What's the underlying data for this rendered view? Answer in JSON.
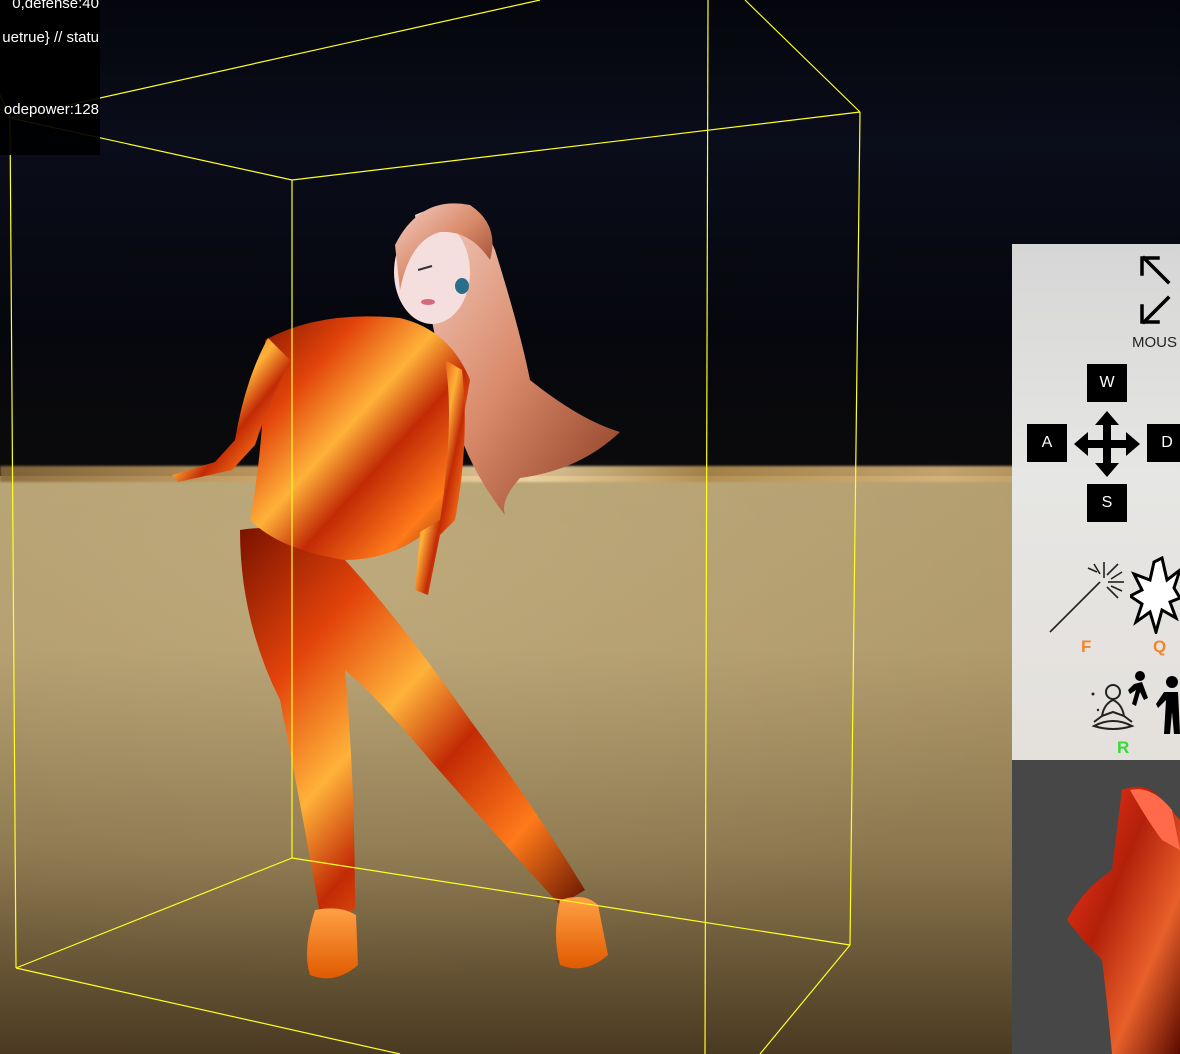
{
  "debug": {
    "line1": "0,defense:40",
    "line2": "uetrue} // statu",
    "line3": "odepower:128"
  },
  "controls": {
    "mouse_label": "MOUS",
    "keys": {
      "up": "W",
      "left": "A",
      "right": "D",
      "down": "S"
    },
    "skills": {
      "f": "F",
      "q": "Q",
      "r": "R"
    }
  },
  "colors": {
    "bounding_box": "#ffff22",
    "skill_f": "#f0862a",
    "skill_q": "#f0862a",
    "skill_r": "#33dd33"
  }
}
